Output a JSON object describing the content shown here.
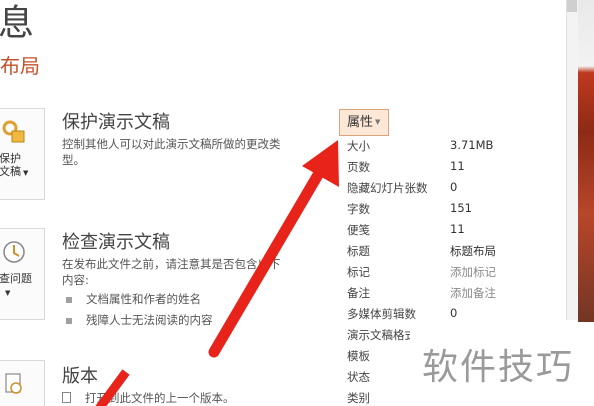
{
  "header": {
    "title": "息",
    "file_name": "布局"
  },
  "sections": [
    {
      "button_label": "保护\n文稿",
      "title": "保护演示文稿",
      "description": "控制其他人可以对此演示文稿所做的更改类型。"
    },
    {
      "button_label": "查问题",
      "title": "检查演示文稿",
      "description": "在发布此文件之前，请注意其是否包含以下内容:",
      "bullets": [
        "文档属性和作者的姓名",
        "残障人士无法阅读的内容"
      ]
    },
    {
      "title": "版本",
      "description": "打开到此文件的上一个版本。"
    }
  ],
  "properties": {
    "button_label": "属性",
    "rows": [
      {
        "key": "大小",
        "value": "3.71MB"
      },
      {
        "key": "页数",
        "value": "11"
      },
      {
        "key": "隐藏幻灯片张数",
        "value": "0"
      },
      {
        "key": "字数",
        "value": "151"
      },
      {
        "key": "便笺",
        "value": "11"
      },
      {
        "key": "标题",
        "value": "标题布局"
      },
      {
        "key": "标记",
        "value": "添加标记",
        "hint": true
      },
      {
        "key": "备注",
        "value": "添加备注",
        "hint": true
      },
      {
        "key": "多媒体剪辑数",
        "value": "0"
      },
      {
        "key": "演示文稿格式",
        "value": ""
      },
      {
        "key": "模板",
        "value": ""
      },
      {
        "key": "状态",
        "value": ""
      },
      {
        "key": "类别",
        "value": ""
      }
    ]
  },
  "watermark": "软件技巧",
  "colors": {
    "accent": "#c5512a",
    "arrow": "#e8231a",
    "prop_button_bg": "#fde7d6"
  }
}
